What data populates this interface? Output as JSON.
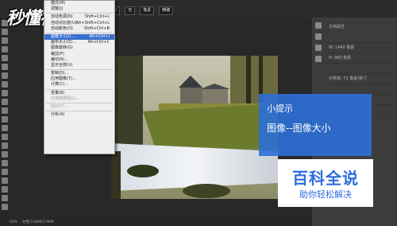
{
  "options_bar": {
    "fields": [
      "0",
      "无",
      "像素",
      "精确"
    ]
  },
  "menu": {
    "items": [
      {
        "label": "模式(M)",
        "shortcut": "",
        "highlight": false,
        "disabled": false
      },
      {
        "label": "调整(J)",
        "shortcut": "",
        "highlight": false,
        "disabled": false
      },
      {
        "sep": true
      },
      {
        "label": "自动色调(N)",
        "shortcut": "Shift+Ctrl+L",
        "highlight": false,
        "disabled": false
      },
      {
        "label": "自动对比度(U)",
        "shortcut": "Alt+Shift+Ctrl+L",
        "highlight": false,
        "disabled": false
      },
      {
        "label": "自动颜色(O)",
        "shortcut": "Shift+Ctrl+B",
        "highlight": false,
        "disabled": false
      },
      {
        "sep": true
      },
      {
        "label": "图像大小(I)...",
        "shortcut": "Alt+Ctrl+I",
        "highlight": true,
        "disabled": false
      },
      {
        "label": "画布大小(S)...",
        "shortcut": "Alt+Ctrl+C",
        "highlight": false,
        "disabled": false
      },
      {
        "label": "图像旋转(G)",
        "shortcut": "",
        "highlight": false,
        "disabled": false
      },
      {
        "label": "裁剪(P)",
        "shortcut": "",
        "highlight": false,
        "disabled": false
      },
      {
        "label": "裁切(R)...",
        "shortcut": "",
        "highlight": false,
        "disabled": false
      },
      {
        "label": "显示全部(V)",
        "shortcut": "",
        "highlight": false,
        "disabled": false
      },
      {
        "sep": true
      },
      {
        "label": "复制(D)...",
        "shortcut": "",
        "highlight": false,
        "disabled": false
      },
      {
        "label": "应用图像(Y)...",
        "shortcut": "",
        "highlight": false,
        "disabled": false
      },
      {
        "label": "计算(C)...",
        "shortcut": "",
        "highlight": false,
        "disabled": false
      },
      {
        "sep": true
      },
      {
        "label": "变量(B)",
        "shortcut": "",
        "highlight": false,
        "disabled": false
      },
      {
        "label": "应用数据组(L)...",
        "shortcut": "",
        "highlight": false,
        "disabled": true
      },
      {
        "sep": true
      },
      {
        "label": "陷印(T)...",
        "shortcut": "",
        "highlight": false,
        "disabled": true
      },
      {
        "sep": true
      },
      {
        "label": "分析(A)",
        "shortcut": "",
        "highlight": false,
        "disabled": false
      }
    ]
  },
  "watermark": {
    "logo": "秒懂视频"
  },
  "tip": {
    "title": "小提示",
    "body": "图像--图像大小"
  },
  "brand": {
    "main": "百科全说",
    "sub": "助你轻松解决"
  },
  "right_panel": {
    "rows": [
      "文档属性",
      "",
      "W: 1440 像素",
      "H: 960 像素",
      "",
      "分辨率: 72 像素/英寸",
      "",
      "",
      ""
    ]
  },
  "statusbar": {
    "zoom": "50%",
    "doc": "文档:3.96M/3.96M"
  },
  "colors": {
    "accent": "#3a6fd0",
    "tip_bg": "#2c6fd6",
    "brand_text": "#2e6de0"
  }
}
